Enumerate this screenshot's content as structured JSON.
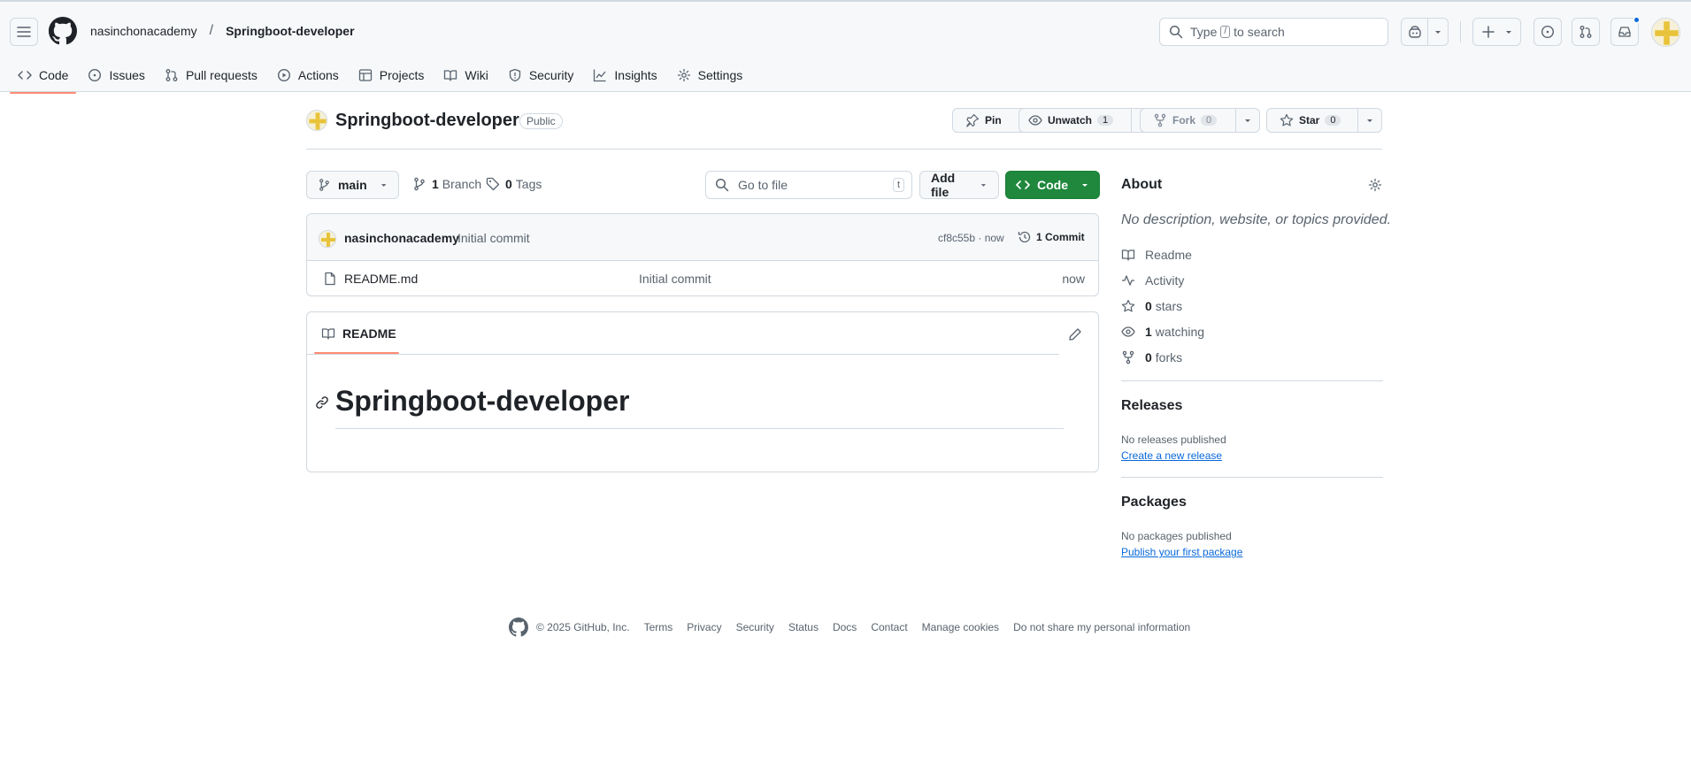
{
  "header": {
    "owner": "nasinchonacademy",
    "separator": "/",
    "repo": "Springboot-developer",
    "search_prefix": "Type",
    "search_key": "/",
    "search_suffix": "to search"
  },
  "repo_nav": [
    {
      "label": "Code",
      "icon": "code-icon"
    },
    {
      "label": "Issues",
      "icon": "issue-opened-icon"
    },
    {
      "label": "Pull requests",
      "icon": "pull-request-icon"
    },
    {
      "label": "Actions",
      "icon": "play-icon"
    },
    {
      "label": "Projects",
      "icon": "table-icon"
    },
    {
      "label": "Wiki",
      "icon": "book-icon"
    },
    {
      "label": "Security",
      "icon": "shield-icon"
    },
    {
      "label": "Insights",
      "icon": "graph-icon"
    },
    {
      "label": "Settings",
      "icon": "gear-icon"
    }
  ],
  "repo_title": {
    "name": "Springboot-developer",
    "visibility": "Public",
    "pin_label": "Pin",
    "watch_label": "Unwatch",
    "watch_count": "1",
    "fork_label": "Fork",
    "fork_count": "0",
    "star_label": "Star",
    "star_count": "0"
  },
  "branch_bar": {
    "branch": "main",
    "branch_count": "1",
    "branch_label": "Branch",
    "tag_count": "0",
    "tag_label": "Tags",
    "goto_placeholder": "Go to file",
    "goto_key": "t",
    "add_file_label": "Add file",
    "code_label": "Code"
  },
  "latest_commit": {
    "author": "nasinchonacademy",
    "message": "Initial commit",
    "sha_time": "cf8c55b · now",
    "commits_label": "1 Commit"
  },
  "files": [
    {
      "name": "README.md",
      "message": "Initial commit",
      "age": "now"
    }
  ],
  "readme": {
    "tab_label": "README",
    "heading": "Springboot-developer"
  },
  "sidebar": {
    "about_title": "About",
    "description": "No description, website, or topics provided.",
    "readme_link": "Readme",
    "activity_link": "Activity",
    "stars_count": "0",
    "stars_label": "stars",
    "watching_count": "1",
    "watching_label": "watching",
    "forks_count": "0",
    "forks_label": "forks",
    "releases_title": "Releases",
    "releases_empty": "No releases published",
    "releases_link": "Create a new release",
    "packages_title": "Packages",
    "packages_empty": "No packages published",
    "packages_link": "Publish your first package"
  },
  "footer": {
    "copyright": "© 2025 GitHub, Inc.",
    "links": [
      "Terms",
      "Privacy",
      "Security",
      "Status",
      "Docs",
      "Contact",
      "Manage cookies",
      "Do not share my personal information"
    ]
  },
  "colors": {
    "accent_tab": "#fd8c73",
    "primary_button": "#1f883d",
    "link": "#0969da",
    "notification_dot": "#0969da"
  }
}
